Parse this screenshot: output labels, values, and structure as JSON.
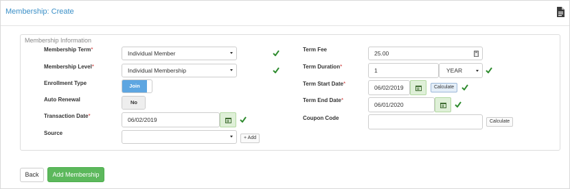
{
  "header": {
    "title": "Membership: Create",
    "icon": "document-icon"
  },
  "panel": {
    "legend": "Membership Information"
  },
  "form": {
    "membership_term": {
      "label": "Membership Term",
      "required_mark": "*",
      "value": "Individual Member"
    },
    "membership_level": {
      "label": "Membership Level",
      "required_mark": "*",
      "value": "Individual Membership"
    },
    "enrollment_type": {
      "label": "Enrollment Type",
      "toggle_label": "Join"
    },
    "auto_renewal": {
      "label": "Auto Renewal",
      "toggle_label": "No"
    },
    "transaction_date": {
      "label": "Transaction Date",
      "required_mark": "*",
      "value": "06/02/2019"
    },
    "source": {
      "label": "Source",
      "value": "",
      "add_label": "+ Add"
    },
    "term_fee": {
      "label": "Term Fee",
      "value": "25.00"
    },
    "term_duration": {
      "label": "Term Duration",
      "required_mark": "*",
      "value": "1",
      "unit": "YEAR"
    },
    "term_start_date": {
      "label": "Term Start Date",
      "required_mark": "*",
      "value": "06/02/2019",
      "calculate_label": "Calculate"
    },
    "term_end_date": {
      "label": "Term End Date",
      "required_mark": "*",
      "value": "06/01/2020"
    },
    "coupon_code": {
      "label": "Coupon Code",
      "value": "",
      "calculate_label": "Calculate"
    }
  },
  "footer": {
    "back_label": "Back",
    "add_label": "Add Membership"
  },
  "colors": {
    "accent": "#3a8fc7",
    "success": "#5cb85c",
    "check": "#2e8b2e",
    "toggle_on": "#5ea6e1",
    "calendar_bg": "#dff0d8"
  }
}
